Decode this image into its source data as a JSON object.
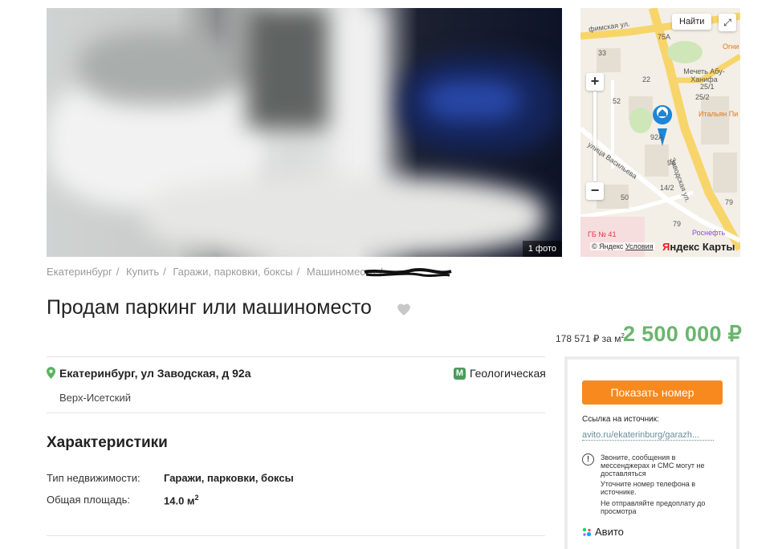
{
  "gallery": {
    "photo_count": "1 фото"
  },
  "map": {
    "find_button": "Найти",
    "zoom_in": "+",
    "zoom_out": "−",
    "streets": [
      "фимская ул.",
      "Заводская ул.",
      "улица Васильева"
    ],
    "house_numbers": [
      "75A",
      "33",
      "22",
      "52",
      "92A",
      "94",
      "25/1",
      "25/2",
      "14/2",
      "79",
      "79",
      "50"
    ],
    "pois": [
      "Огни",
      "Мечеть Абу-Ханифа",
      "Итальян Пи",
      "Роснефть",
      "ГБ № 41"
    ],
    "copyright": "© Яндекс",
    "terms": "Условия",
    "brand_ya": "Я",
    "brand_rest": "ндекс Карты",
    "colors": {
      "road_yellow": "#f8d56b",
      "land": "#f3efe6",
      "park": "#cfe6b8",
      "pin": "#1f86d6"
    }
  },
  "breadcrumb": [
    "Екатеринбург",
    "Купить",
    "Гаражи, парковки, боксы",
    "Машиноместа"
  ],
  "listing": {
    "title": "Продам паркинг или машиноместо",
    "price_per_m2": "178 571 ₽ за м",
    "price_per_m2_sup": "2",
    "price": "2 500 000 ₽",
    "address": "Екатеринбург, ул Заводская, д 92а",
    "metro_icon": "М",
    "metro": "Геологическая",
    "district": "Верх-Исетский"
  },
  "characteristics": {
    "title": "Характеристики",
    "rows": [
      {
        "label": "Тип недвижимости:",
        "value": "Гаражи, парковки, боксы"
      },
      {
        "label": "Общая площадь:",
        "value": "14.0 м",
        "sup": "2"
      }
    ]
  },
  "sidebar": {
    "show_phone": "Показать номер",
    "source_label": "Ссылка на источник:",
    "source_link": "avito.ru/ekaterinburg/garazh...",
    "warnings": [
      "Звоните, сообщения в мессенджерах и СМС могут не доставляться",
      "Уточните номер телефона в источнике.",
      "Не отправляйте предоплату до просмотра"
    ],
    "warning_icon": "!",
    "source_brand": "Авито"
  }
}
